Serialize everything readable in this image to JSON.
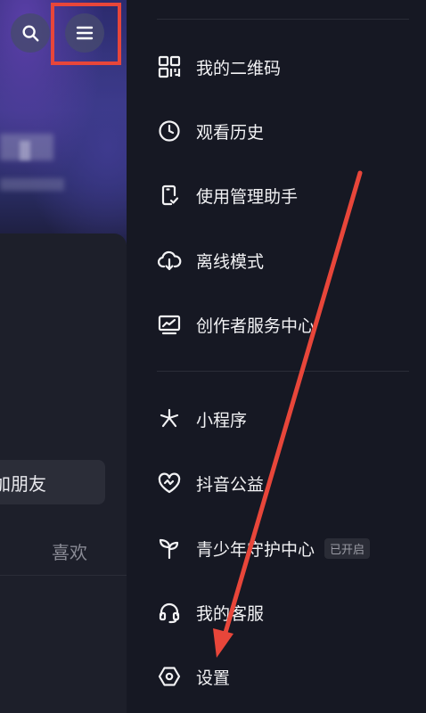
{
  "left_panel": {
    "add_friend_label": "加朋友",
    "like_tab_label": "喜欢"
  },
  "drawer": {
    "group1": [
      {
        "label": "我的二维码",
        "icon": "qr-code-icon"
      },
      {
        "label": "观看历史",
        "icon": "clock-icon"
      },
      {
        "label": "使用管理助手",
        "icon": "phone-check-icon"
      },
      {
        "label": "离线模式",
        "icon": "cloud-download-icon"
      },
      {
        "label": "创作者服务中心",
        "icon": "monitor-chart-icon"
      }
    ],
    "group2": [
      {
        "label": "小程序",
        "icon": "mini-program-icon"
      },
      {
        "label": "抖音公益",
        "icon": "heart-pulse-icon"
      },
      {
        "label": "青少年守护中心",
        "icon": "sprout-icon",
        "badge": "已开启"
      },
      {
        "label": "我的客服",
        "icon": "headset-icon"
      },
      {
        "label": "设置",
        "icon": "settings-hexagon-icon"
      }
    ]
  },
  "annotations": {
    "highlight_color": "#e8463a",
    "arrow_color": "#e8463a"
  }
}
